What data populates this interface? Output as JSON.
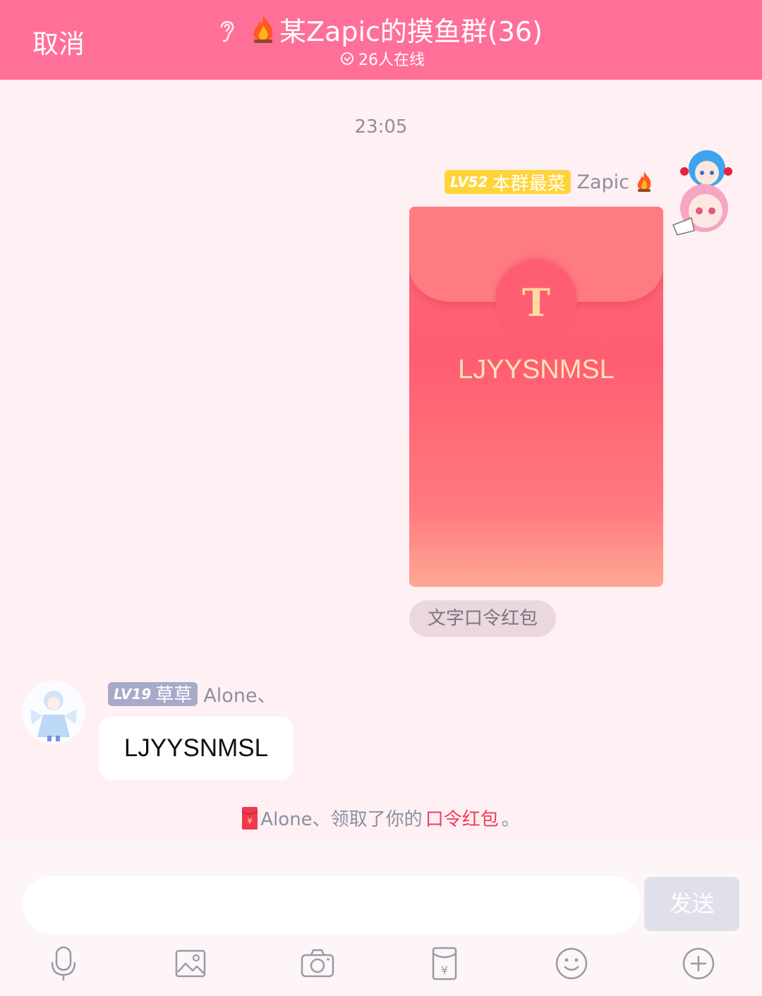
{
  "header": {
    "cancel_label": "取消",
    "title": "某Zapic的摸鱼群(36)",
    "online_text": "26人在线"
  },
  "chat": {
    "timestamp": "23:05",
    "my_message": {
      "level": "LV52",
      "title": "本群最菜",
      "name": "Zapic",
      "red_packet_code": "LJYYSNMSL",
      "red_packet_type": "文字口令红包"
    },
    "other_message": {
      "level": "LV19",
      "title": "草草",
      "name": "Alone、",
      "text": "LJYYSNMSL"
    },
    "system_message": {
      "prefix": "Alone、领取了你的",
      "highlight": "口令红包",
      "suffix": "。"
    }
  },
  "composer": {
    "input_value": "",
    "send_label": "发送"
  },
  "toolbar": {
    "icons": [
      "mic-icon",
      "image-icon",
      "camera-icon",
      "red-packet-icon",
      "emoji-icon",
      "plus-icon"
    ]
  },
  "colors": {
    "header": "#ff7098",
    "background": "#fff0f4",
    "highlight": "#f03c5a",
    "gold_badge": "#ffd43b",
    "gray_badge": "#a7abc9"
  }
}
